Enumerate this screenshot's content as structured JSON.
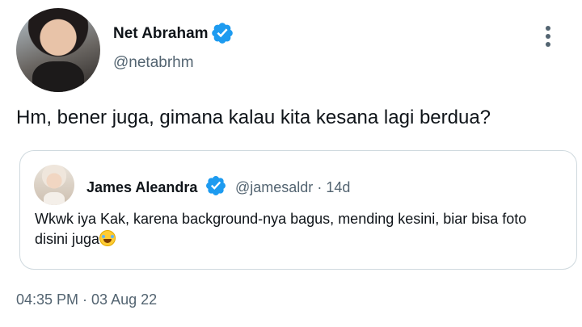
{
  "tweet": {
    "author": {
      "name": "Net Abraham",
      "handle": "@netabrhm",
      "verified": true
    },
    "text": "Hm, bener juga, gimana kalau kita kesana lagi berdua?",
    "quoted": {
      "name": "James Aleandra",
      "handle": "@jamesaldr",
      "separator": "·",
      "age": "14d",
      "verified": true,
      "text": "Wkwk iya Kak, karena background-nya bagus, mending kesini, biar bisa foto disini juga",
      "emoji": "face-with-tears-of-joy"
    },
    "timestamp": "04:35 PM · 03 Aug 22"
  },
  "colors": {
    "verified": "#1d9bf0",
    "secondary_text": "#536471",
    "border": "#cfd9de"
  },
  "icons": {
    "verified": "verified-badge-icon",
    "more": "more-vertical-icon"
  }
}
